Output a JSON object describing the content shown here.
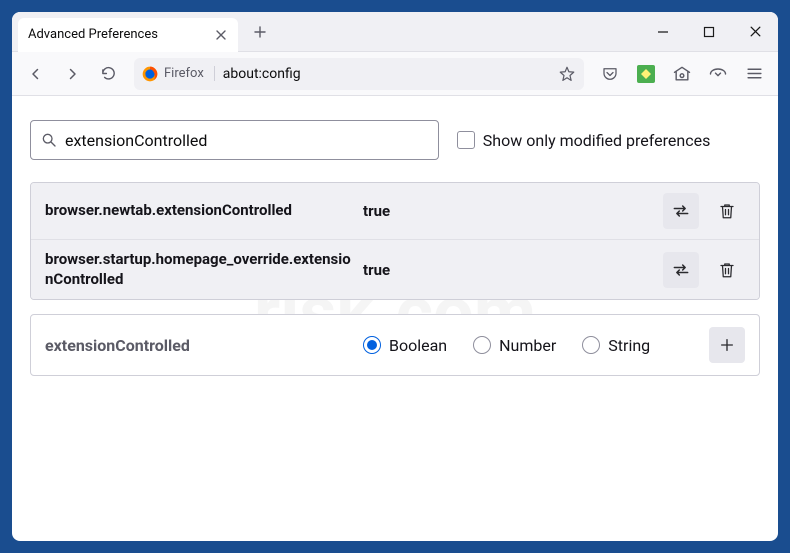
{
  "tab": {
    "title": "Advanced Preferences"
  },
  "urlbar": {
    "identity_label": "Firefox",
    "url": "about:config"
  },
  "search": {
    "value": "extensionControlled"
  },
  "checkbox": {
    "label": "Show only modified preferences"
  },
  "prefs": [
    {
      "name": "browser.newtab.extensionControlled",
      "value": "true"
    },
    {
      "name": "browser.startup.homepage_override.extensionControlled",
      "value": "true"
    }
  ],
  "newpref": {
    "name": "extensionControlled",
    "types": [
      "Boolean",
      "Number",
      "String"
    ],
    "selected": "Boolean"
  },
  "watermark": "pcrisk.com"
}
